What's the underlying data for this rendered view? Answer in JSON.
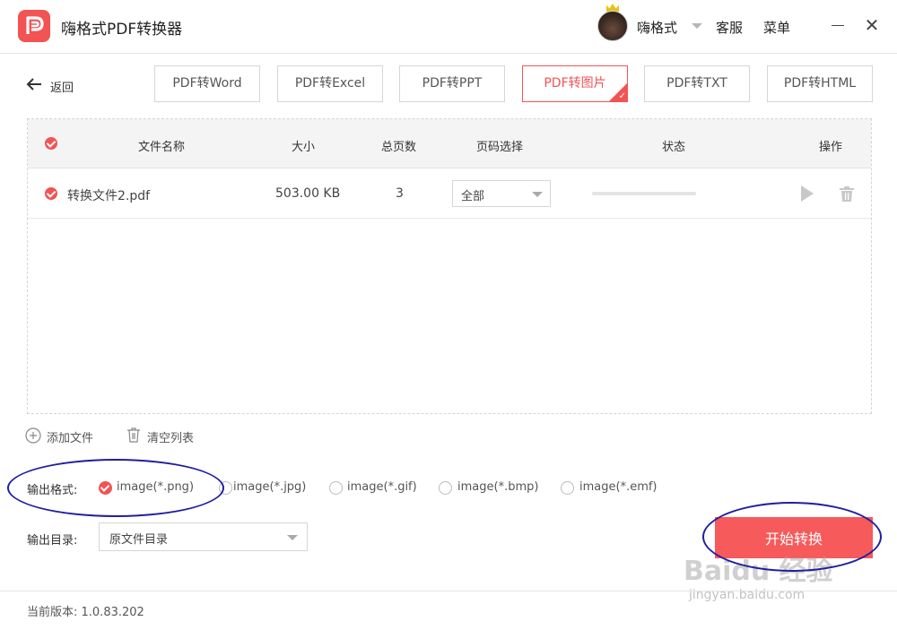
{
  "app": {
    "title": "嗨格式PDF转换器"
  },
  "header": {
    "username": "嗨格式",
    "service_label": "客服",
    "menu_label": "菜单"
  },
  "toolbar": {
    "back_label": "返回",
    "tabs": [
      {
        "label": "PDF转Word",
        "active": false
      },
      {
        "label": "PDF转Excel",
        "active": false
      },
      {
        "label": "PDF转PPT",
        "active": false
      },
      {
        "label": "PDF转图片",
        "active": true
      },
      {
        "label": "PDF转TXT",
        "active": false
      },
      {
        "label": "PDF转HTML",
        "active": false
      }
    ]
  },
  "table": {
    "columns": [
      "文件名称",
      "大小",
      "总页数",
      "页码选择",
      "状态",
      "操作"
    ],
    "rows": [
      {
        "filename": "转换文件2.pdf",
        "size": "503.00 KB",
        "pages": "3",
        "page_selection": "全部",
        "progress": 0
      }
    ]
  },
  "actions": {
    "add_file": "添加文件",
    "clear_list": "清空列表"
  },
  "output_format": {
    "label": "输出格式:",
    "options": [
      "image(*.png)",
      "image(*.jpg)",
      "image(*.gif)",
      "image(*.bmp)",
      "image(*.emf)"
    ],
    "selected_index": 0
  },
  "output_dir": {
    "label": "输出目录:",
    "value": "原文件目录"
  },
  "start_button": "开始转换",
  "footer": {
    "version": "当前版本: 1.0.83.202"
  },
  "colors": {
    "accent": "#f25353",
    "annotation": "#1f1f9e"
  },
  "watermark": {
    "main": "Baidu 经验",
    "sub": "jingyan.baidu.com"
  }
}
